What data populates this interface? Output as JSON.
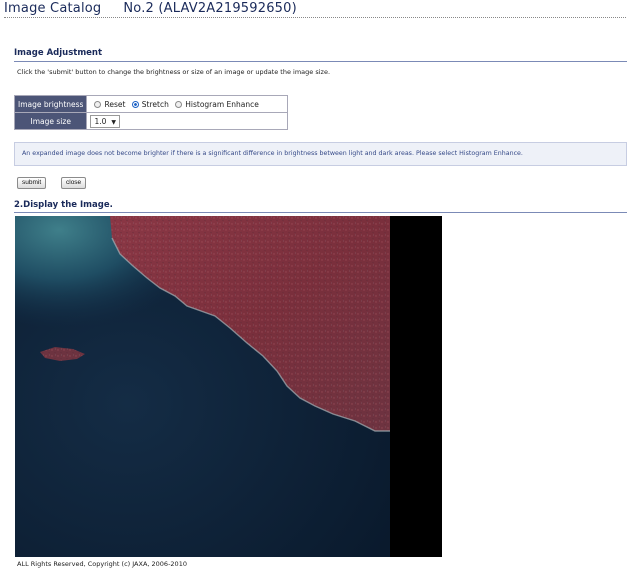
{
  "header": {
    "catalog_label": "Image Catalog",
    "number_label": "No.2 (ALAV2A219592650)"
  },
  "adjustment": {
    "heading": "Image Adjustment",
    "instruction": "Click the 'submit' button to change the brightness or size of an image or update the image size.",
    "brightness_label": "Image brightness",
    "brightness_options": [
      "Reset",
      "Stretch",
      "Histogram Enhance"
    ],
    "brightness_selected": "Stretch",
    "size_label": "Image size",
    "size_value": "1.0",
    "notice": "An expanded image does not become brighter if there is a significant difference in brightness between light and dark areas. Please select Histogram Enhance."
  },
  "buttons": {
    "submit": "submit",
    "close": "close"
  },
  "display": {
    "heading": "2.Display the Image."
  },
  "footer": {
    "copyright": "ALL Rights Reserved, Copyright (c) JAXA, 2006-2010"
  },
  "colors": {
    "accent": "#4c5577",
    "heading_text": "#1a2a5a",
    "notice_bg": "#eef1f8",
    "notice_text": "#364a88",
    "radio_selected": "#1e63c6",
    "land": "#7d2f3b",
    "sea": "#0e2239"
  }
}
